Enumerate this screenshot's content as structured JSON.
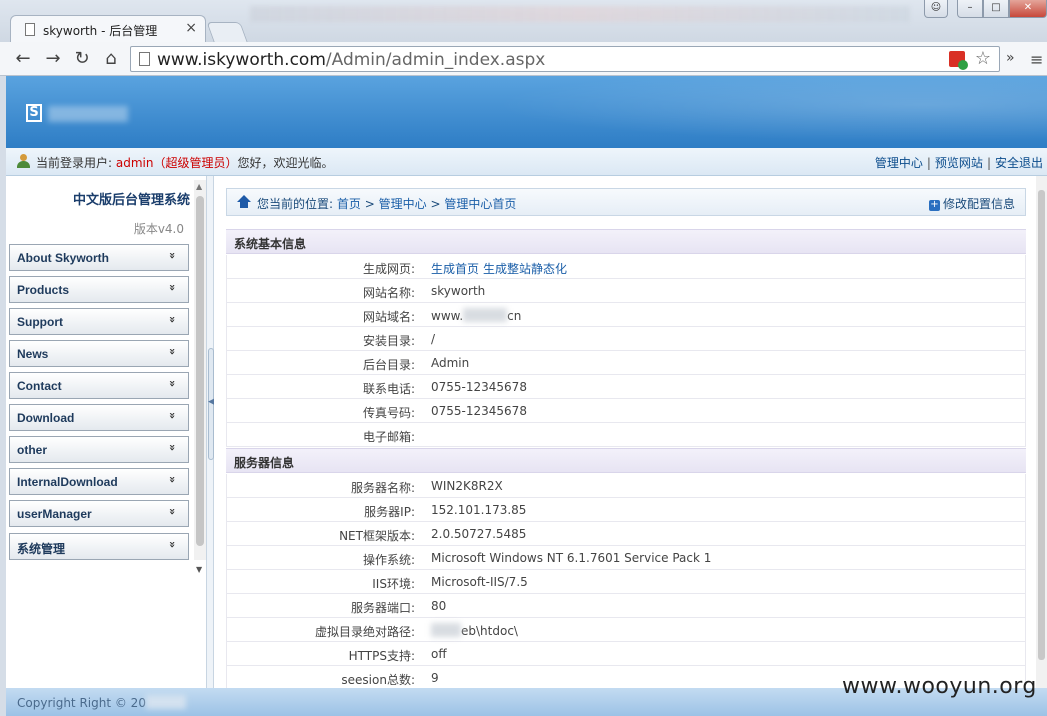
{
  "browser": {
    "tab_title": "skyworth - 后台管理",
    "tab_close": "×",
    "url_host": "www.iskyworth.com",
    "url_path": "/Admin/admin_index.aspx",
    "back": "←",
    "forward": "→",
    "reload": "↻",
    "home": "⌂",
    "star": "☆",
    "overflow": "»",
    "menu": "≡"
  },
  "header": {
    "logo_letter": "S"
  },
  "userbar": {
    "label": "当前登录用户:",
    "username": "admin（超级管理员）",
    "greeting": "您好，欢迎光临。",
    "links": [
      "管理中心",
      "预览网站",
      "安全退出"
    ]
  },
  "sidebar": {
    "system_title": "中文版后台管理系统",
    "version": "版本v4.0",
    "items": [
      {
        "label": "About Skyworth"
      },
      {
        "label": "Products"
      },
      {
        "label": "Support"
      },
      {
        "label": "News"
      },
      {
        "label": "Contact"
      },
      {
        "label": "Download"
      },
      {
        "label": "other"
      },
      {
        "label": "InternalDownload"
      },
      {
        "label": "userManager"
      },
      {
        "label": "系统管理"
      }
    ],
    "expand_glyph": "»"
  },
  "breadcrumb": {
    "prefix": "您当前的位置:",
    "home": "首页",
    "sep": ">",
    "level1": "管理中心",
    "level2": "管理中心首页",
    "edit_label": "修改配置信息",
    "edit_plus": "+"
  },
  "basic_info": {
    "title": "系统基本信息",
    "rows": [
      {
        "key": "生成网页:",
        "links": [
          "生成首页",
          "生成整站静态化"
        ]
      },
      {
        "key": "网站名称:",
        "value": "skyworth"
      },
      {
        "key": "网站域名:",
        "value_prefix": "www.",
        "value_suffix": "cn"
      },
      {
        "key": "安装目录:",
        "value": "/"
      },
      {
        "key": "后台目录:",
        "value": "Admin"
      },
      {
        "key": "联系电话:",
        "value": "0755-12345678"
      },
      {
        "key": "传真号码:",
        "value": "0755-12345678"
      },
      {
        "key": "电子邮箱:",
        "value": ""
      }
    ]
  },
  "server_info": {
    "title": "服务器信息",
    "rows": [
      {
        "key": "服务器名称:",
        "value": "WIN2K8R2X"
      },
      {
        "key": "服务器IP:",
        "value": "152.101.173.85"
      },
      {
        "key": "NET框架版本:",
        "value": "2.0.50727.5485"
      },
      {
        "key": "操作系统:",
        "value": "Microsoft Windows NT 6.1.7601 Service Pack 1"
      },
      {
        "key": "IIS环境:",
        "value": "Microsoft-IIS/7.5"
      },
      {
        "key": "服务器端口:",
        "value": "80"
      },
      {
        "key": "虚拟目录绝对路径:",
        "value": "eb\\htdoc\\"
      },
      {
        "key": "HTTPS支持:",
        "value": "off"
      },
      {
        "key": "seesion总数:",
        "value": "9"
      }
    ]
  },
  "footer": {
    "copyright": "Copyright Right © 20"
  },
  "watermark": "www.wooyun.org"
}
